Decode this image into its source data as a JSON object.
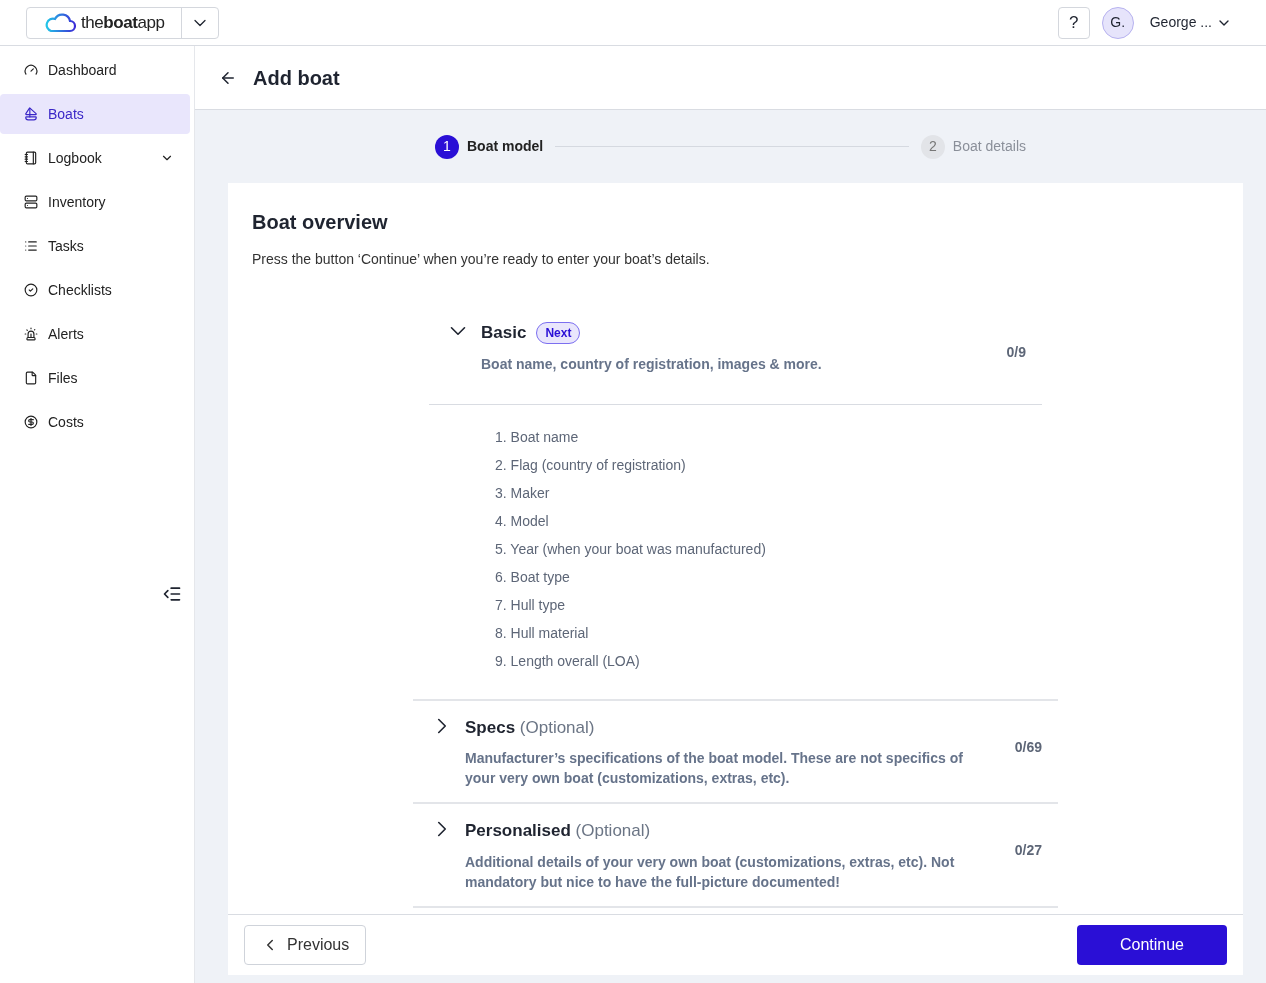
{
  "logo": "the**boat**app",
  "help": "?",
  "user": {
    "initial": "G.",
    "name": "George ..."
  },
  "sidebar": {
    "items": [
      {
        "label": "Dashboard",
        "selected": false
      },
      {
        "label": "Boats",
        "selected": true
      },
      {
        "label": "Logbook",
        "selected": false,
        "expanded": false
      },
      {
        "label": "Inventory",
        "selected": false
      },
      {
        "label": "Tasks",
        "selected": false
      },
      {
        "label": "Checklists",
        "selected": false
      },
      {
        "label": "Alerts",
        "selected": false
      },
      {
        "label": "Files",
        "selected": false
      },
      {
        "label": "Costs",
        "selected": false
      }
    ]
  },
  "page_title": "Add boat",
  "steps": [
    {
      "number": "1",
      "label": "Boat model",
      "selected": true
    },
    {
      "number": "2",
      "label": "Boat details",
      "selected": false
    }
  ],
  "card": {
    "title": "Boat overview",
    "intro": "Press the button ‘Continue’ when you’re ready to enter your boat’s details.",
    "sections": [
      {
        "title": "Basic",
        "badge": "Next",
        "description": "Boat name, country of registration, images & more.",
        "count": "0/9",
        "expanded": true,
        "items": [
          {
            "number": "1.",
            "text": "Boat name"
          },
          {
            "number": "2.",
            "text": "Flag (country of registration)"
          },
          {
            "number": "3.",
            "text": "Maker"
          },
          {
            "number": "4.",
            "text": "Model"
          },
          {
            "number": "5.",
            "text": "Year (when your boat was manufactured)"
          },
          {
            "number": "6.",
            "text": "Boat type"
          },
          {
            "number": "7.",
            "text": "Hull type"
          },
          {
            "number": "8.",
            "text": "Hull material"
          },
          {
            "number": "9.",
            "text": "Length overall (LOA)"
          }
        ]
      },
      {
        "title": "Specs",
        "optional": "(Optional)",
        "description": "Manufacturer’s specifications of the boat model. These are not specifics of your very own boat (customizations, extras, etc).",
        "count": "0/69",
        "expanded": false
      },
      {
        "title": "Personalised",
        "optional": "(Optional)",
        "description": "Additional details of your very own boat (customizations, extras, etc). Not mandatory but nice to have the full-picture documented!",
        "count": "0/27",
        "expanded": false
      }
    ]
  },
  "buttons": {
    "previous": "Previous",
    "continue": "Continue"
  }
}
